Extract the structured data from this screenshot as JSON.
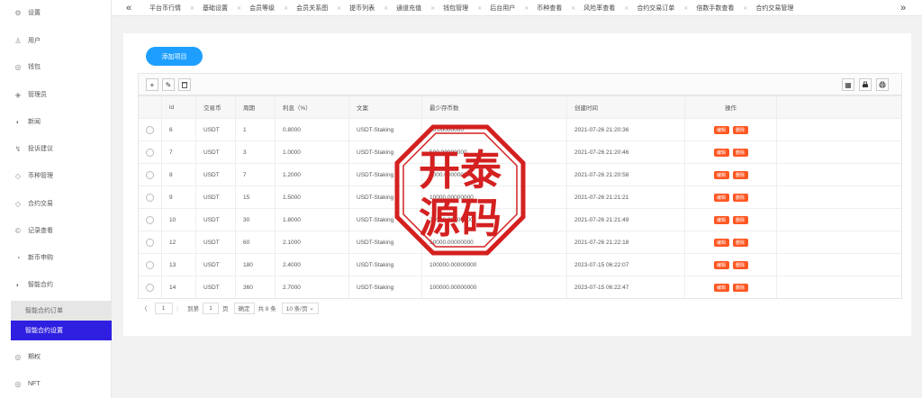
{
  "sidebar": {
    "items": [
      {
        "label": "设置",
        "icon": "gear-icon",
        "glyph": "⚙"
      },
      {
        "label": "用户",
        "icon": "user-icon",
        "glyph": "♙"
      },
      {
        "label": "钱包",
        "icon": "wallet-icon",
        "glyph": "◎"
      },
      {
        "label": "管理员",
        "icon": "shield-icon",
        "glyph": "◈"
      },
      {
        "label": "新闻",
        "icon": "news-icon",
        "glyph": "◐"
      },
      {
        "label": "投诉建议",
        "icon": "feedback-icon",
        "glyph": "↯"
      },
      {
        "label": "币种管理",
        "icon": "coin-icon",
        "glyph": "◇"
      },
      {
        "label": "合约交易",
        "icon": "contract-icon",
        "glyph": "◇"
      },
      {
        "label": "记录查看",
        "icon": "record-icon",
        "glyph": "©"
      },
      {
        "label": "新币申购",
        "icon": "subscribe-icon",
        "glyph": "◔"
      },
      {
        "label": "智能合约",
        "icon": "smart-contract-icon",
        "glyph": "◐"
      }
    ],
    "sub_items": [
      {
        "label": "智能合约订单",
        "state": "muted"
      },
      {
        "label": "智能合约设置",
        "state": "active"
      }
    ],
    "bottom_items": [
      {
        "label": "期权",
        "icon": "option-icon",
        "glyph": "◎"
      },
      {
        "label": "NFT",
        "icon": "nft-icon",
        "glyph": "◎"
      }
    ]
  },
  "tabs": [
    "平台币行情",
    "基础设置",
    "会员等级",
    "会员关系图",
    "提币列表",
    "通道充值",
    "钱包管理",
    "后台用户",
    "币种查看",
    "风险率查看",
    "合约交易订单",
    "倍数手数查看",
    "合约交易管理"
  ],
  "toolbar": {
    "add_label": "添加项目",
    "left_icons": [
      "+",
      "✎",
      "🗑"
    ],
    "right_icons": [
      "▦",
      "⎙",
      "⎚"
    ]
  },
  "table": {
    "headers": [
      "",
      "id",
      "交易币",
      "周期",
      "利息（%）",
      "文案",
      "最少存币数",
      "创建时间",
      "操作",
      ""
    ],
    "rows": [
      [
        "6",
        "USDT",
        "1",
        "0.8000",
        "USDT-Staking",
        "10.00000000",
        "2021-07-26 21:20:36"
      ],
      [
        "7",
        "USDT",
        "3",
        "1.0000",
        "USDT-Staking",
        "500.00000000",
        "2021-07-26 21:20:46"
      ],
      [
        "8",
        "USDT",
        "7",
        "1.2000",
        "USDT-Staking",
        "1000.00000000",
        "2021-07-26 21:20:58"
      ],
      [
        "9",
        "USDT",
        "15",
        "1.5000",
        "USDT-Staking",
        "10000.00000000",
        "2021-07-26 21:21:21"
      ],
      [
        "10",
        "USDT",
        "30",
        "1.8000",
        "USDT-Staking",
        "30000.00000000",
        "2021-07-26 21:21:49"
      ],
      [
        "12",
        "USDT",
        "60",
        "2.1000",
        "USDT-Staking",
        "50000.00000000",
        "2021-07-26 21:22:18"
      ],
      [
        "13",
        "USDT",
        "180",
        "2.4000",
        "USDT-Staking",
        "100000.00000000",
        "2023-07-15 06:22:07"
      ],
      [
        "14",
        "USDT",
        "360",
        "2.7000",
        "USDT-Staking",
        "100000.00000000",
        "2023-07-15 06:22:47"
      ]
    ],
    "edit_label": "编辑",
    "delete_label": "删除"
  },
  "pager": {
    "prev": "〈",
    "current": "1",
    "next": "〉",
    "goto_label": "到第",
    "goto_value": "1",
    "page_unit": "页",
    "confirm_label": "确定",
    "total_label": "共 8 条",
    "size_label": "10 条/页"
  },
  "watermark": {
    "line1": "开泰",
    "line2": "源码",
    "color": "#d42020"
  }
}
